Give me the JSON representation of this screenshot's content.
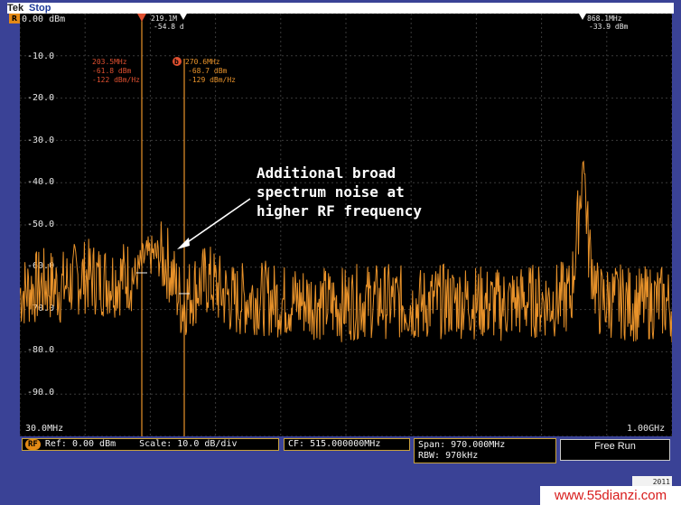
{
  "header": {
    "brand": "Tek",
    "state": "Stop"
  },
  "channel_marker": {
    "label": "R"
  },
  "axis": {
    "y_labels": [
      "0.00 dBm",
      "-10.0",
      "-20.0",
      "-30.0",
      "-40.0",
      "-50.0",
      "-60.0",
      "-70.0",
      "-80.0",
      "-90.0"
    ],
    "x_start": "30.0MHz",
    "x_end": "1.00GHz"
  },
  "markers": {
    "reference": {
      "freq": "219.1M",
      "level": "-54.8 d"
    },
    "right": {
      "freq": "868.1MHz",
      "level": "-33.9 dBm"
    },
    "a": {
      "freq": "203.5MHz",
      "level": "-61.8 dBm",
      "density": "-122 dBm/Hz"
    },
    "b": {
      "badge": "b",
      "freq": "270.6MHz",
      "level": "-68.7 dBm",
      "density": "-129 dBm/Hz"
    }
  },
  "annotation": {
    "line1": "Additional broad",
    "line2": "spectrum noise at",
    "line3": "higher RF frequency"
  },
  "status": {
    "rf_tag": "RF",
    "ref": "Ref: 0.00 dBm",
    "scale": "Scale: 10.0 dB/div",
    "cf": "CF: 515.000000MHz",
    "span": "Span:   970.000MHz",
    "rbw": "RBW:    970kHz",
    "run": "Free Run"
  },
  "bottom_tag": "2011",
  "watermark": "www.55dianzi.com",
  "colors": {
    "trace": "#e8922a",
    "grid": "#3a3a3a",
    "marker_red": "#e05030",
    "marker_orange": "#e48a16",
    "frame": "#3a4296"
  },
  "chart_data": {
    "type": "line",
    "x_range_mhz": [
      30,
      1000
    ],
    "ylim": [
      -100,
      0
    ],
    "ylabel": "dBm",
    "grid": true,
    "series": [
      {
        "x_mhz": [
          30,
          50,
          70,
          90,
          110,
          130,
          150,
          170,
          190,
          203.5,
          215,
          230,
          250,
          270.6,
          290,
          310,
          330,
          350,
          380,
          420,
          460,
          500,
          540,
          580,
          620,
          660,
          700,
          740,
          780,
          820,
          850,
          860,
          868.1,
          876,
          890,
          920,
          950,
          980,
          1000
        ],
        "y_dbm": [
          -66,
          -65,
          -64,
          -65,
          -63,
          -62,
          -63,
          -63,
          -62,
          -61.8,
          -58,
          -57,
          -59,
          -68.7,
          -65,
          -63,
          -66,
          -68,
          -67,
          -68,
          -68,
          -69,
          -68,
          -68,
          -69,
          -68,
          -68,
          -69,
          -68,
          -68,
          -67,
          -50,
          -33.9,
          -55,
          -68,
          -68,
          -69,
          -68,
          -69
        ]
      }
    ]
  }
}
